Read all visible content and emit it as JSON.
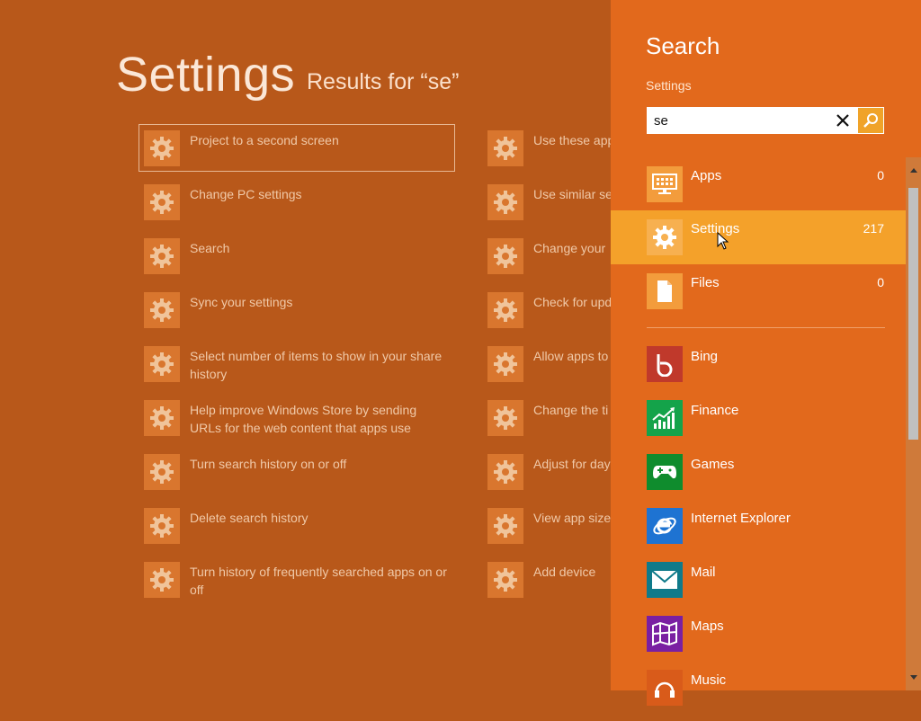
{
  "main": {
    "title": "Settings",
    "results_for": "Results for “se”",
    "left_items": [
      {
        "label": "Project to a second screen"
      },
      {
        "label": "Change PC settings"
      },
      {
        "label": "Search"
      },
      {
        "label": "Sync your settings"
      },
      {
        "label": "Select number of items to show in your share history"
      },
      {
        "label": "Help improve Windows Store by sending URLs for the web content that apps use"
      },
      {
        "label": "Turn search history on or off"
      },
      {
        "label": "Delete search history"
      },
      {
        "label": "Turn history of frequently searched apps on or off"
      }
    ],
    "right_items": [
      {
        "label": "Use these app"
      },
      {
        "label": "Use similar se"
      },
      {
        "label": "Change your"
      },
      {
        "label": "Check for upd"
      },
      {
        "label": "Allow apps to"
      },
      {
        "label": "Change the ti"
      },
      {
        "label": "Adjust for day automatically"
      },
      {
        "label": "View app size"
      },
      {
        "label": "Add device"
      }
    ]
  },
  "search_pane": {
    "title": "Search",
    "scope": "Settings",
    "query": "se",
    "categories": [
      {
        "name": "Apps",
        "count": "0",
        "icon": "apps-icon"
      },
      {
        "name": "Settings",
        "count": "217",
        "icon": "gear-icon"
      },
      {
        "name": "Files",
        "count": "0",
        "icon": "file-icon"
      }
    ],
    "apps": [
      {
        "name": "Bing",
        "icon": "bing-icon",
        "color": "#c0392b"
      },
      {
        "name": "Finance",
        "icon": "finance-icon",
        "color": "#14a34a"
      },
      {
        "name": "Games",
        "icon": "games-icon",
        "color": "#0f8c2d"
      },
      {
        "name": "Internet Explorer",
        "icon": "internet-explorer-icon",
        "color": "#1e73d2"
      },
      {
        "name": "Mail",
        "icon": "mail-icon",
        "color": "#0f7a8a"
      },
      {
        "name": "Maps",
        "icon": "maps-icon",
        "color": "#7a1fa2"
      },
      {
        "name": "Music",
        "icon": "music-icon",
        "color": "#d95b1a"
      }
    ]
  },
  "colors": {
    "background": "#b8581a",
    "pane": "#e2691c",
    "selected": "#f4a12a",
    "tile": "#d9762e"
  }
}
